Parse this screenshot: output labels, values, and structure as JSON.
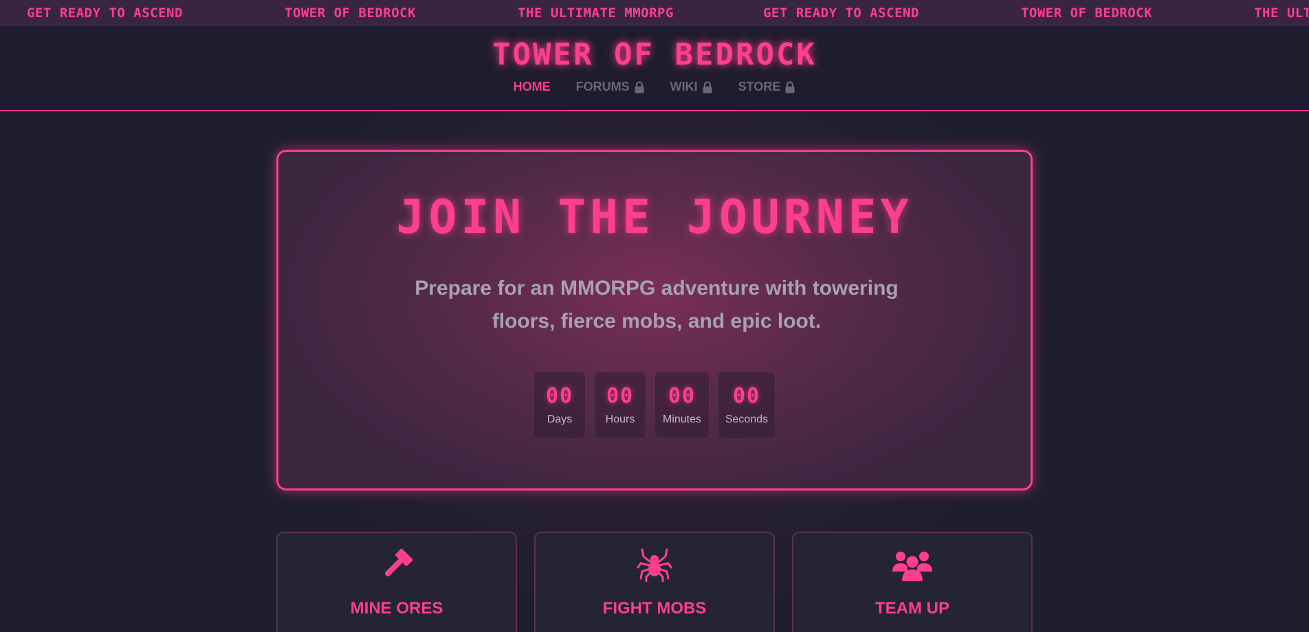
{
  "ticker": [
    "GET READY TO ASCEND",
    "TOWER OF BEDROCK",
    "THE ULTIMATE MMORPG",
    "GET READY TO ASCEND",
    "TOWER OF BEDROCK",
    "THE ULTIMATE MMORPG"
  ],
  "header": {
    "title": "TOWER OF BEDROCK",
    "nav": [
      {
        "label": "HOME",
        "locked": false
      },
      {
        "label": "FORUMS",
        "locked": true
      },
      {
        "label": "WIKI",
        "locked": true
      },
      {
        "label": "STORE",
        "locked": true
      }
    ]
  },
  "hero": {
    "title": "JOIN THE JOURNEY",
    "subtitle_line1": "Prepare for an MMORPG adventure with towering",
    "subtitle_line2": "floors, fierce mobs, and epic loot.",
    "countdown": [
      {
        "value": "00",
        "label": "Days"
      },
      {
        "value": "00",
        "label": "Hours"
      },
      {
        "value": "00",
        "label": "Minutes"
      },
      {
        "value": "00",
        "label": "Seconds"
      }
    ]
  },
  "features": [
    {
      "icon": "hammer-icon",
      "title": "MINE ORES"
    },
    {
      "icon": "spider-icon",
      "title": "FIGHT MOBS"
    },
    {
      "icon": "users-icon",
      "title": "TEAM UP"
    }
  ],
  "colors": {
    "accent": "#ff3f8e",
    "background": "#1f1e30",
    "muted": "#6a6778"
  }
}
